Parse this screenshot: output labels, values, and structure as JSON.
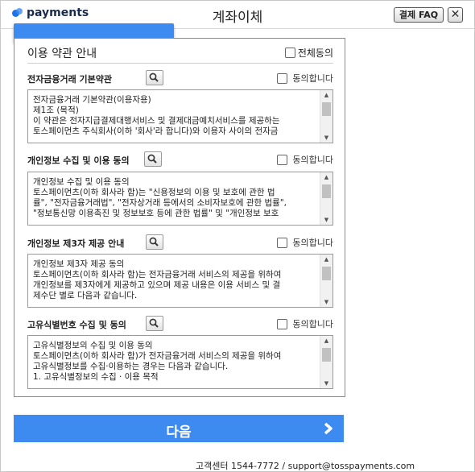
{
  "header": {
    "logo_text": "payments",
    "title": "계좌이체",
    "faq_label": "결제 FAQ",
    "close_label": "✕"
  },
  "terms": {
    "all_title": "이용 약관 안내",
    "all_agree_label": "전체동의",
    "sections": [
      {
        "title": "전자금융거래 기본약관",
        "agree_label": "동의합니다",
        "lines": [
          "전자금융거래 기본약관(이용자용)",
          "제1조 (목적)",
          "이 약관은 전자지급결제대행서비스 및 결제대금예치서비스를 제공하는",
          "토스페이먼츠 주식회사(이하 '회사'라 합니다)와 이용자 사이의 전자금"
        ]
      },
      {
        "title": "개인정보 수집 및 이용 동의",
        "agree_label": "동의합니다",
        "lines": [
          "개인정보 수집 및 이용 동의",
          "토스페이먼츠(이하 회사라 함)는 \"신용정보의 이용 및 보호에 관한 법",
          "률\", \"전자금융거래법\", \"전자상거래 등에서의 소비자보호에 관한 법률\",",
          "\"정보통신망 이용촉진 및 정보보호 등에 관한 법률\" 및 \"개인정보 보호"
        ]
      },
      {
        "title": "개인정보 제3자 제공 안내",
        "agree_label": "동의합니다",
        "lines": [
          "개인정보 제3자 제공 동의",
          "토스페이먼츠(이하 회사라 함)는 전자금융거래 서비스의 제공을 위하여",
          "개인정보를 제3자에게 제공하고 있으며 제공 내용은 이용 서비스 및 결",
          "제수단 별로 다음과 같습니다."
        ]
      },
      {
        "title": "고유식별번호 수집 및 동의",
        "agree_label": "동의합니다",
        "lines": [
          "고유식별정보의 수집 및 이용 동의",
          "토스페이먼츠(이하 회사라 함)가 전자금융거래 서비스의 제공을 위하여",
          "고유식별정보를 수집·이용하는 경우는 다음과 같습니다.",
          "1. 고유식별정보의 수집 · 이용 목적"
        ]
      }
    ]
  },
  "next_button": {
    "label": "다음"
  },
  "footer": {
    "support": "고객센터 1544-7772 / support@tosspayments.com"
  },
  "icons": {
    "search": "magnifier-icon",
    "next": "chevron-right-icon"
  },
  "colors": {
    "accent": "#3d8bf0"
  }
}
